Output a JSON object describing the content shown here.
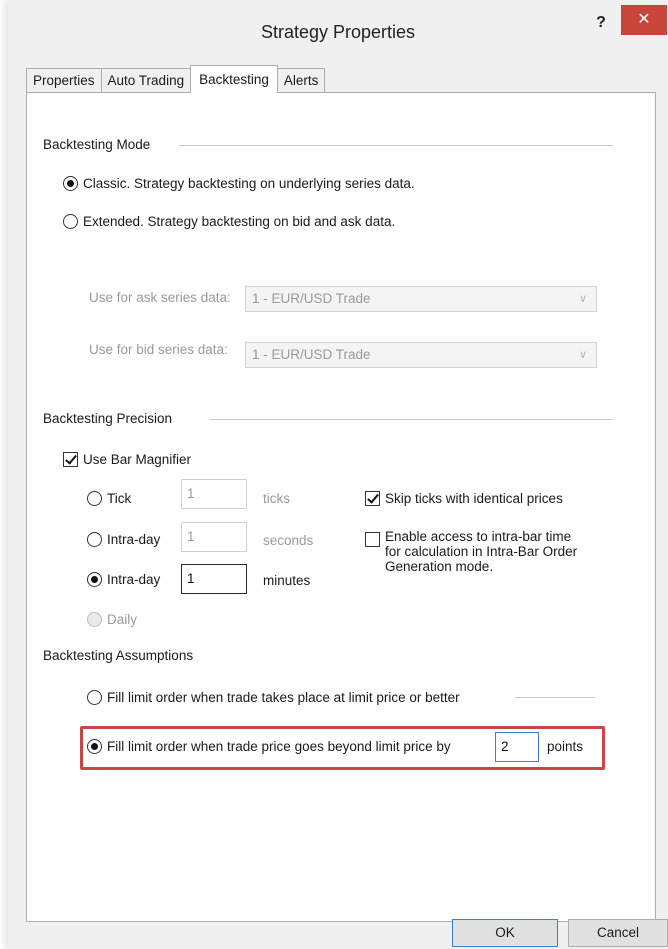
{
  "window": {
    "title": "Strategy Properties",
    "help_label": "?",
    "close_label": "✕"
  },
  "tabs": [
    {
      "label": "Properties"
    },
    {
      "label": "Auto Trading"
    },
    {
      "label": "Backtesting"
    },
    {
      "label": "Alerts"
    }
  ],
  "active_tab": "Backtesting",
  "mode": {
    "heading": "Backtesting Mode",
    "classic_label": "Classic. Strategy backtesting on underlying series data.",
    "extended_label": "Extended. Strategy backtesting on bid and ask data.",
    "selected": "classic",
    "ask_label": "Use for ask series data:",
    "ask_value": "1 - EUR/USD Trade",
    "bid_label": "Use for bid series data:",
    "bid_value": "1 - EUR/USD Trade"
  },
  "precision": {
    "heading": "Backtesting Precision",
    "bar_magnifier_label": "Use Bar Magnifier",
    "bar_magnifier_checked": true,
    "tick_label": "Tick",
    "tick_value": "1",
    "tick_unit": "ticks",
    "intraday_sec_label": "Intra-day",
    "intraday_sec_value": "1",
    "intraday_sec_unit": "seconds",
    "intraday_min_label": "Intra-day",
    "intraday_min_value": "1",
    "intraday_min_unit": "minutes",
    "daily_label": "Daily",
    "selected": "intraday_minutes",
    "skip_ticks_label": "Skip ticks with identical prices",
    "skip_ticks_checked": true,
    "intrabar_line1": "Enable access to intra-bar time",
    "intrabar_line2": "for calculation in Intra-Bar Order",
    "intrabar_line3": "Generation mode.",
    "intrabar_checked": false
  },
  "assumptions": {
    "heading": "Backtesting Assumptions",
    "option1_label": "Fill limit order when trade takes place at limit price or better",
    "option2_label": "Fill limit order when trade price goes beyond limit price by",
    "option2_value": "2",
    "option2_unit": "points",
    "selected": "option2"
  },
  "buttons": {
    "ok_label": "OK",
    "cancel_label": "Cancel"
  },
  "colors": {
    "close_bg": "#c7453a",
    "highlight_border": "#c74747",
    "focus_border": "#3c7fd1"
  }
}
